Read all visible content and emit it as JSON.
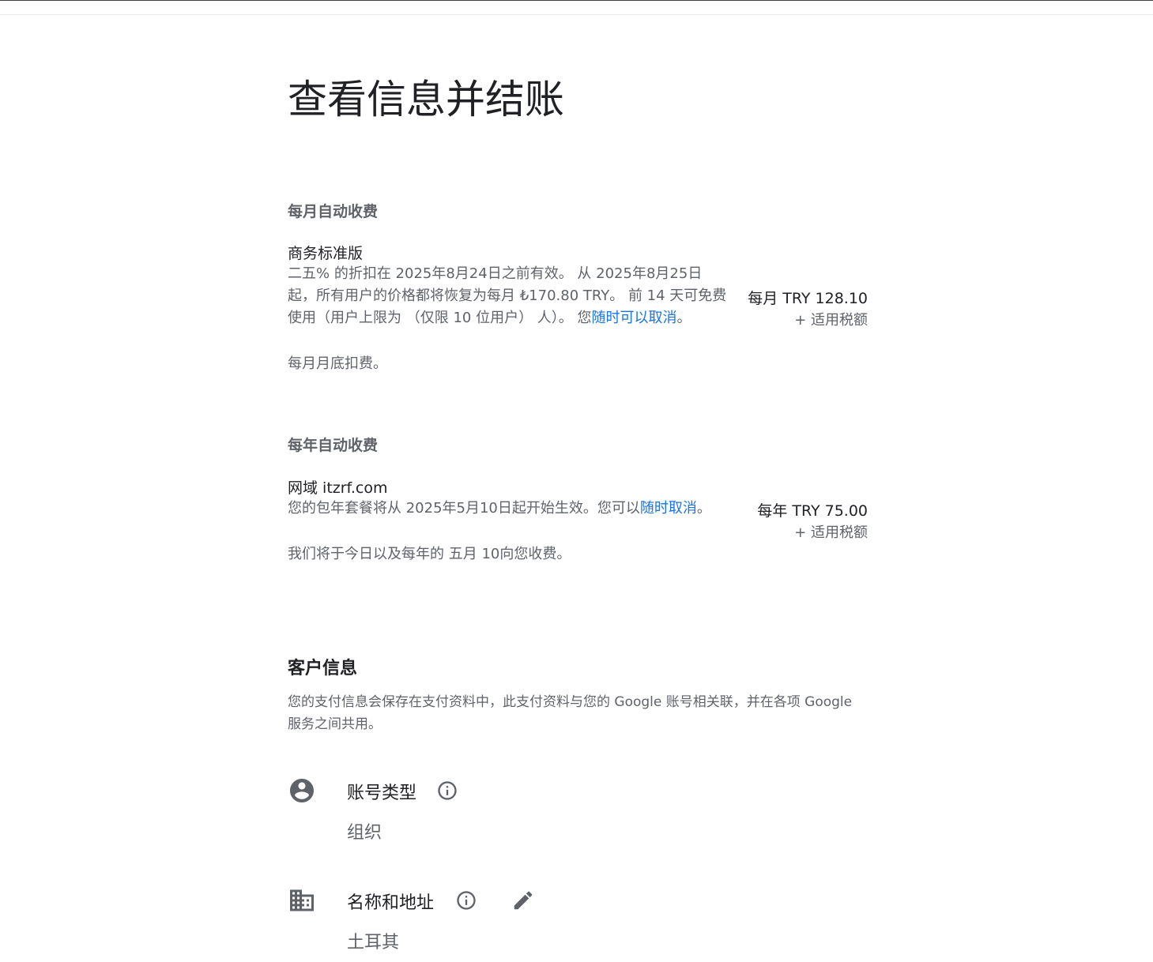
{
  "page_title": "查看信息并结账",
  "monthly": {
    "section_label": "每月自动收费",
    "item_name": "商务标准版",
    "desc_before_link": "二五% 的折扣在 2025年8月24日之前有效。 从 2025年8月25日起，所有用户的价格都将恢复为每月 ₺170.80 TRY。 前 14 天可免费使用（用户上限为 （仅限 10 位用户） 人）。 您",
    "desc_link": "随时可以取消",
    "desc_after_link": "。",
    "note": "每月月底扣费。",
    "price": "每月 TRY 128.10",
    "tax": "+ 适用税额"
  },
  "yearly": {
    "section_label": "每年自动收费",
    "item_name": "网域 itzrf.com",
    "desc_before_link": "您的包年套餐将从 2025年5月10日起开始生效。您可以",
    "desc_link": "随时取消",
    "desc_after_link": "。",
    "note": "我们将于今日以及每年的 五月 10向您收费。",
    "price": "每年 TRY 75.00",
    "tax": "+ 适用税额"
  },
  "customer": {
    "heading": "客户信息",
    "description": "您的支付信息会保存在支付资料中，此支付资料与您的 Google 账号相关联，并在各项 Google 服务之间共用。",
    "account_type": {
      "title": "账号类型",
      "value": "组织"
    },
    "name_address": {
      "title": "名称和地址",
      "value": "土耳其"
    }
  },
  "colors": {
    "link": "#1a73e8",
    "secondary_text": "#5f6368",
    "primary_text": "#202124"
  },
  "icons": {
    "account": "account-circle-icon",
    "info": "info-icon",
    "building": "business-icon",
    "edit": "edit-pencil-icon"
  }
}
